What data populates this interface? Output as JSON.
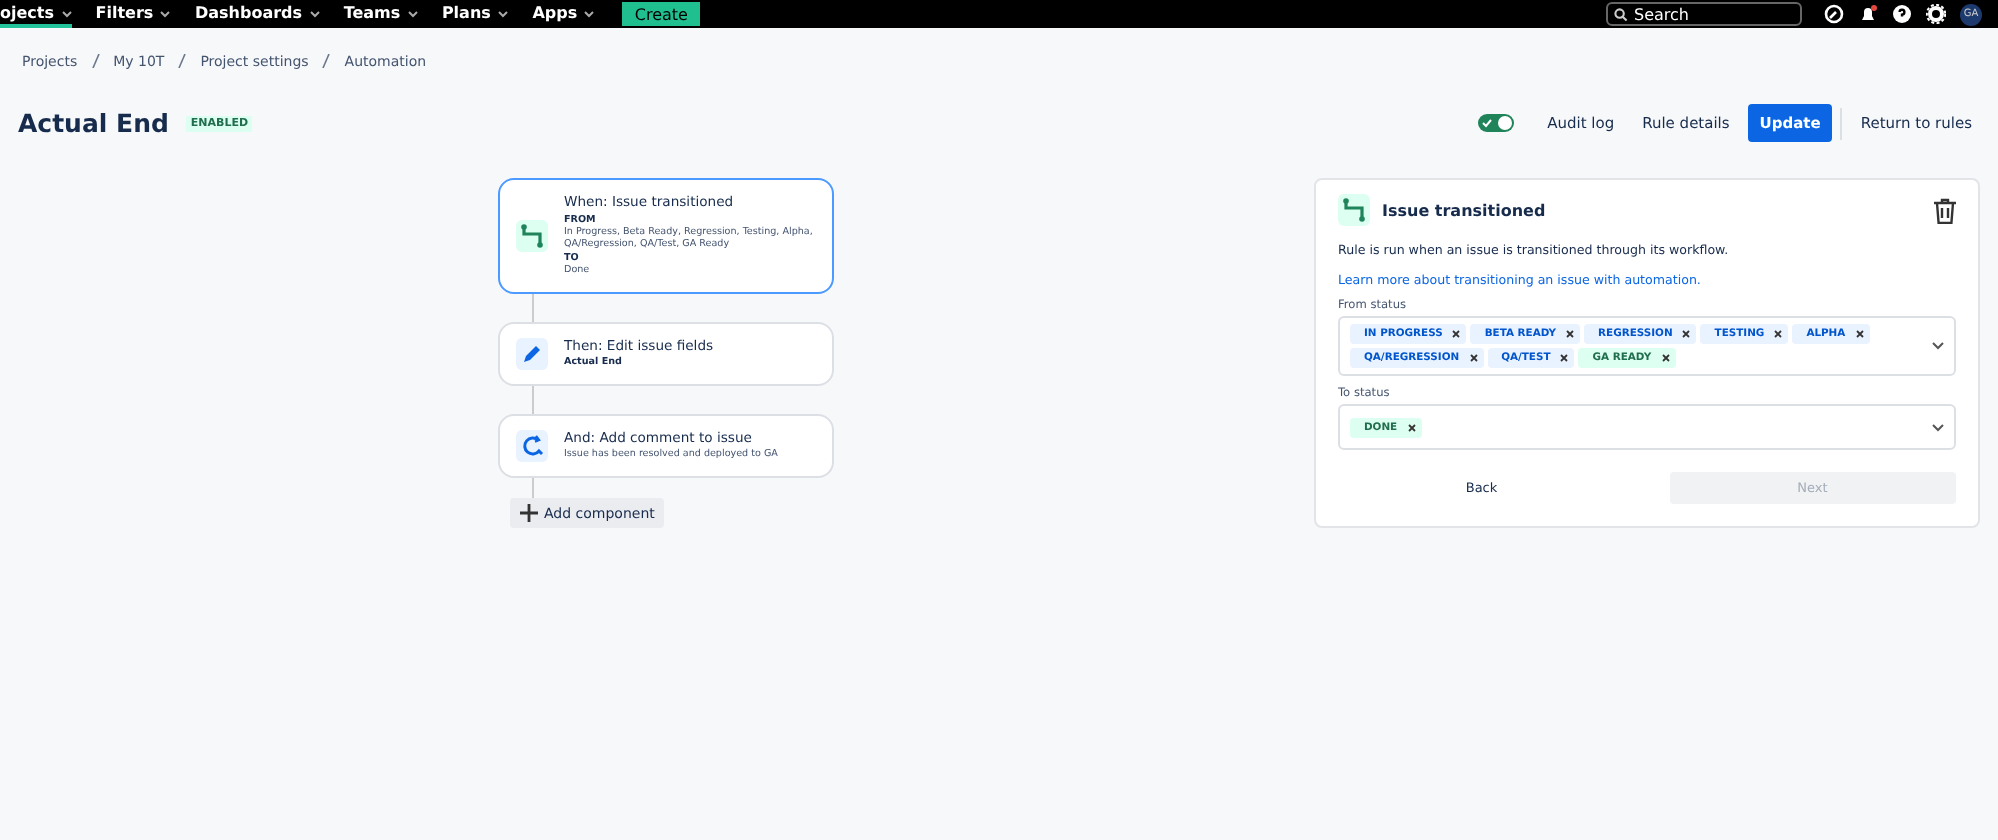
{
  "top_nav": {
    "items": [
      {
        "label": "ojects",
        "selected": true
      },
      {
        "label": "Filters",
        "selected": false
      },
      {
        "label": "Dashboards",
        "selected": false
      },
      {
        "label": "Teams",
        "selected": false
      },
      {
        "label": "Plans",
        "selected": false
      },
      {
        "label": "Apps",
        "selected": false
      }
    ],
    "create_button": "Create",
    "search": {
      "placeholder": "Search"
    },
    "avatar": "GA"
  },
  "breadcrumbs": [
    "Projects",
    "My 10T",
    "Project settings",
    "Automation"
  ],
  "rule": {
    "title": "Actual End",
    "status": "ENABLED",
    "enabled": true
  },
  "actions": {
    "audit_log": "Audit log",
    "rule_details": "Rule details",
    "update": "Update",
    "return": "Return to rules"
  },
  "flow": [
    {
      "kind": "trigger",
      "selected": true,
      "title": "When: Issue transitioned",
      "lines": [
        {
          "text": "FROM",
          "strong": true
        },
        {
          "text": "In Progress, Beta Ready, Regression, Testing, Alpha, QA/Regression, QA/Test, GA Ready",
          "strong": false
        },
        {
          "text": "TO",
          "strong": true
        },
        {
          "text": "Done",
          "strong": false
        }
      ]
    },
    {
      "kind": "edit",
      "selected": false,
      "title": "Then: Edit issue fields",
      "lines": [
        {
          "text": "Actual End",
          "strong": true
        }
      ]
    },
    {
      "kind": "comment",
      "selected": false,
      "title": "And: Add comment to issue",
      "lines": [
        {
          "text": "Issue has been resolved and deployed to GA",
          "strong": false
        }
      ]
    }
  ],
  "add_component": "Add component",
  "panel": {
    "title": "Issue transitioned",
    "description": "Rule is run when an issue is transitioned through its workflow.",
    "link": "Learn more about transitioning an issue with automation.",
    "from_label": "From status",
    "from": [
      {
        "label": "IN PROGRESS",
        "color": "#0055cc"
      },
      {
        "label": "BETA READY",
        "color": "#0055cc"
      },
      {
        "label": "REGRESSION",
        "color": "#0055cc"
      },
      {
        "label": "TESTING",
        "color": "#0055cc"
      },
      {
        "label": "ALPHA",
        "color": "#0055cc"
      },
      {
        "label": "QA/REGRESSION",
        "color": "#0055cc"
      },
      {
        "label": "QA/TEST",
        "color": "#0055cc"
      },
      {
        "label": "GA READY",
        "color": "#216e4e"
      }
    ],
    "to_label": "To status",
    "to": [
      {
        "label": "DONE",
        "color": "#216e4e"
      }
    ],
    "back": "Back",
    "next": "Next",
    "next_disabled": true
  }
}
